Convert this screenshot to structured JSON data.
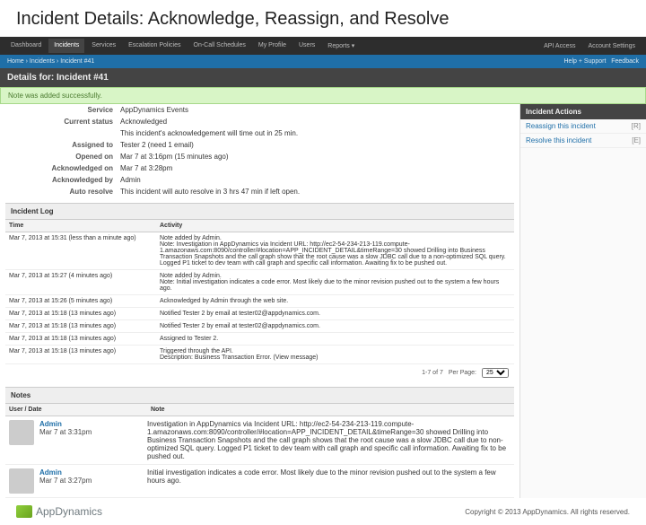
{
  "page_title": "Incident Details: Acknowledge, Reassign, and Resolve",
  "topnav": {
    "left": [
      "Dashboard",
      "Incidents",
      "Services",
      "Escalation Policies",
      "On-Call Schedules",
      "My Profile",
      "Users",
      "Reports ▾"
    ],
    "active_index": 1,
    "right": [
      "API Access",
      "Account Settings"
    ]
  },
  "breadcrumb": {
    "items": [
      "Home",
      "Incidents",
      "Incident #41"
    ],
    "help": "Help + Support",
    "feedback": "Feedback"
  },
  "details_header": "Details for: Incident #41",
  "flash": "Note was added successfully.",
  "actions": {
    "title": "Incident Actions",
    "items": [
      {
        "label": "Reassign this incident",
        "key": "R"
      },
      {
        "label": "Resolve this incident",
        "key": "E"
      }
    ]
  },
  "summary": [
    {
      "k": "Service",
      "v": "AppDynamics Events",
      "link": true
    },
    {
      "k": "Current status",
      "v": "Acknowledged",
      "ack": true
    },
    {
      "k": "",
      "v": "This incident's acknowledgement will time out in 25 min."
    },
    {
      "k": "Assigned to",
      "v": "Tester 2 (need 1 email)",
      "link": true
    },
    {
      "k": "Opened on",
      "v": "Mar 7 at 3:16pm (15 minutes ago)"
    },
    {
      "k": "Acknowledged on",
      "v": "Mar 7 at 3:28pm"
    },
    {
      "k": "Acknowledged by",
      "v": "Admin",
      "link": true
    },
    {
      "k": "Auto resolve",
      "v": "This incident will auto resolve in 3 hrs 47 min if left open."
    }
  ],
  "log": {
    "title": "Incident Log",
    "headers": [
      "Time",
      "Activity"
    ],
    "rows": [
      {
        "t": "Mar 7, 2013 at 15:31 (less than a minute ago)",
        "a": "Note added by Admin.\nNote: Investigation in AppDynamics via Incident URL: http://ec2-54-234-213-119.compute-1.amazonaws.com:8090/controller/#location=APP_INCIDENT_DETAIL&timeRange=30 showed Drilling into Business Transaction Snapshots and the call graph show that the root cause was a slow JDBC call due to a non-optimized SQL query. Logged P1 ticket to dev team with call graph and specific call information. Awaiting fix to be pushed out."
      },
      {
        "t": "Mar 7, 2013 at 15:27 (4 minutes ago)",
        "a": "Note added by Admin.\nNote: Initial investigation indicates a code error. Most likely due to the minor revision pushed out to the system a few hours ago."
      },
      {
        "t": "Mar 7, 2013 at 15:26 (5 minutes ago)",
        "a": "Acknowledged by Admin through the web site."
      },
      {
        "t": "Mar 7, 2013 at 15:18 (13 minutes ago)",
        "a": "Notified Tester 2 by email at tester02@appdynamics.com."
      },
      {
        "t": "Mar 7, 2013 at 15:18 (13 minutes ago)",
        "a": "Notified Tester 2 by email at tester02@appdynamics.com."
      },
      {
        "t": "Mar 7, 2013 at 15:18 (13 minutes ago)",
        "a": "Assigned to Tester 2."
      },
      {
        "t": "Mar 7, 2013 at 15:18 (13 minutes ago)",
        "a": "Triggered through the API.\nDescription: Business Transaction Error. (View message)"
      }
    ],
    "pager": {
      "status": "1-7 of 7",
      "label": "Per Page:",
      "value": "25"
    }
  },
  "notes": {
    "title": "Notes",
    "headers": [
      "User / Date",
      "Note"
    ],
    "rows": [
      {
        "user": "Admin",
        "date": "Mar 7 at 3:31pm",
        "body": "Investigation in AppDynamics via Incident URL: http://ec2-54-234-213-119.compute-1.amazonaws.com:8090/controller/#location=APP_INCIDENT_DETAIL&timeRange=30 showed Drilling into Business Transaction Snapshots and the call graph shows that the root cause was a slow JDBC call due to non-optimized SQL query. Logged P1 ticket to dev team with call graph and specific call information. Awaiting fix to be pushed out."
      },
      {
        "user": "Admin",
        "date": "Mar 7 at 3:27pm",
        "body": "Initial investigation indicates a code error. Most likely due to the minor revision pushed out to the system a few hours ago."
      }
    ]
  },
  "footer": {
    "brand": "AppDynamics",
    "copyright": "Copyright © 2013 AppDynamics. All rights reserved."
  }
}
